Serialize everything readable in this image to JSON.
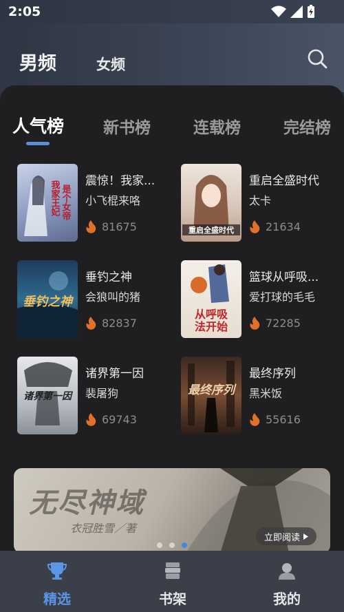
{
  "status_bar": {
    "time": "2:05"
  },
  "top_tabs": [
    {
      "label": "男频",
      "active": true
    },
    {
      "label": "女频",
      "active": false
    }
  ],
  "rank_tabs": [
    {
      "label": "人气榜",
      "active": true
    },
    {
      "label": "新书榜",
      "active": false
    },
    {
      "label": "连载榜",
      "active": false
    },
    {
      "label": "完结榜",
      "active": false
    }
  ],
  "books": [
    {
      "title": "震惊！我家...",
      "author": "小飞棍来咯",
      "heat": "81675",
      "cover_text": "我家王妃是个女帝",
      "cover_color": "#9aa7c6"
    },
    {
      "title": "重启全盛时代",
      "author": "太卡",
      "heat": "21634",
      "cover_text": "重启全盛时代",
      "cover_color": "#d7c7bd"
    },
    {
      "title": "垂钓之神",
      "author": "会狼叫的猪",
      "heat": "82837",
      "cover_text": "垂钓之神",
      "cover_color": "#2f5f8a"
    },
    {
      "title": "篮球从呼吸...",
      "author": "爱打球的毛毛",
      "heat": "72285",
      "cover_text": "从呼吸法开始",
      "cover_color": "#e7dfd2"
    },
    {
      "title": "诸界第一因",
      "author": "裴屠狗",
      "heat": "69743",
      "cover_text": "诸界第一因",
      "cover_color": "#cfd2d6"
    },
    {
      "title": "最终序列",
      "author": "黑米饭",
      "heat": "55616",
      "cover_text": "最终序列",
      "cover_color": "#6b4a36"
    }
  ],
  "banner": {
    "title": "无尽神域",
    "subtitle": "衣冠胜雪／著",
    "button": "立即阅读"
  },
  "bottom_nav": [
    {
      "label": "精选",
      "active": true
    },
    {
      "label": "书架",
      "active": false
    },
    {
      "label": "我的",
      "active": false
    }
  ],
  "colors": {
    "accent": "#5b95e6",
    "flame": "#e0702a"
  }
}
